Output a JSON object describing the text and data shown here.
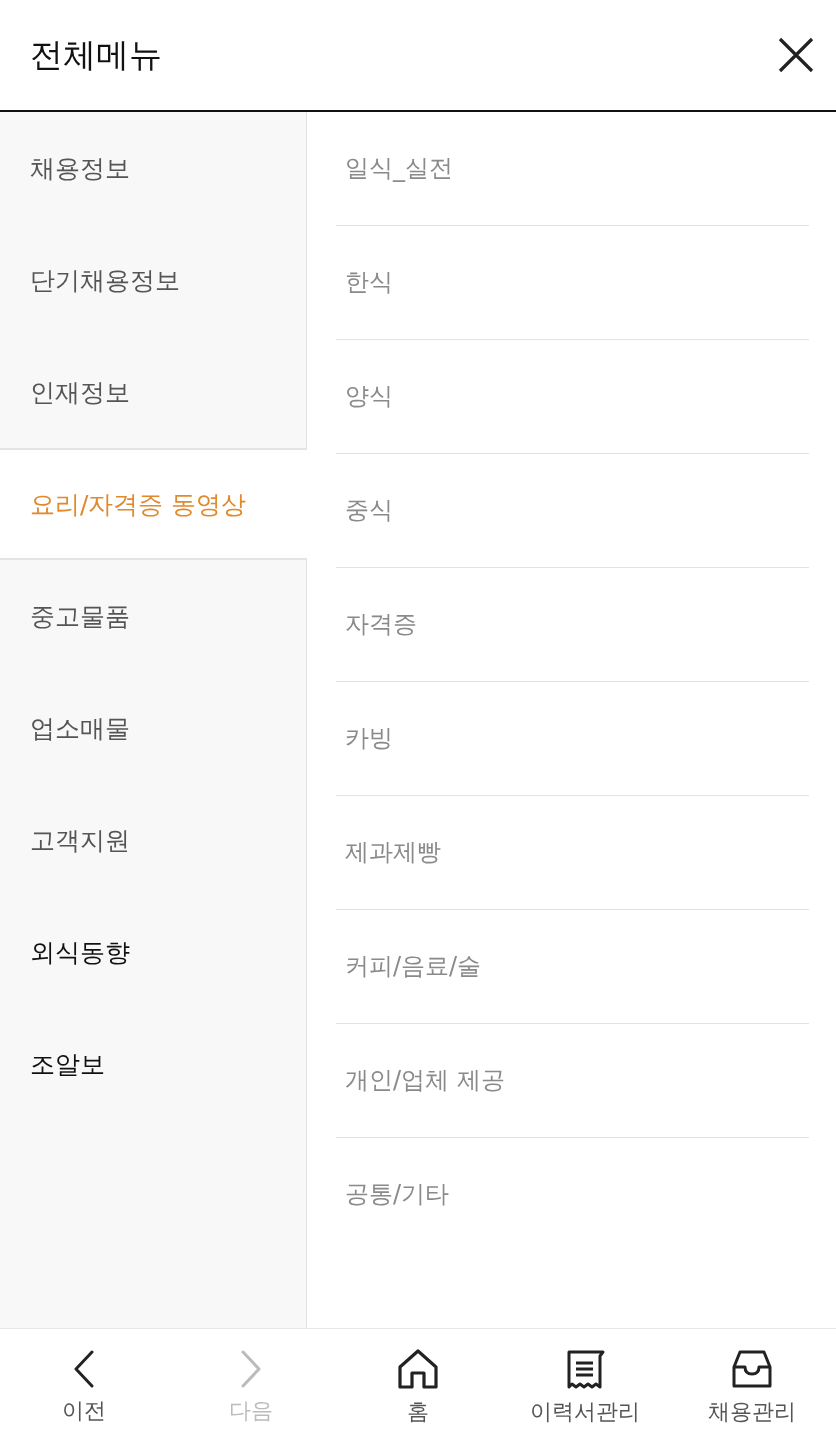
{
  "header": {
    "title": "전체메뉴"
  },
  "menu": {
    "items": [
      {
        "label": "채용정보",
        "kind": "category",
        "selected": false
      },
      {
        "label": "단기채용정보",
        "kind": "category",
        "selected": false
      },
      {
        "label": "인재정보",
        "kind": "category",
        "selected": false
      },
      {
        "label": "요리/자격증 동영상",
        "kind": "category",
        "selected": true
      },
      {
        "label": "중고물품",
        "kind": "category",
        "selected": false
      },
      {
        "label": "업소매물",
        "kind": "category",
        "selected": false
      },
      {
        "label": "고객지원",
        "kind": "category",
        "selected": false
      },
      {
        "label": "외식동향",
        "kind": "link",
        "selected": false
      },
      {
        "label": "조알보",
        "kind": "link",
        "selected": false
      }
    ]
  },
  "submenu": {
    "items": [
      "일식_실전",
      "한식",
      "양식",
      "중식",
      "자격증",
      "카빙",
      "제과제빵",
      "커피/음료/술",
      "개인/업체 제공",
      "공통/기타"
    ]
  },
  "bottom_nav": {
    "items": [
      {
        "label": "이전",
        "disabled": false
      },
      {
        "label": "다음",
        "disabled": true
      },
      {
        "label": "홈",
        "disabled": false
      },
      {
        "label": "이력서관리",
        "disabled": false
      },
      {
        "label": "채용관리",
        "disabled": false
      }
    ]
  }
}
